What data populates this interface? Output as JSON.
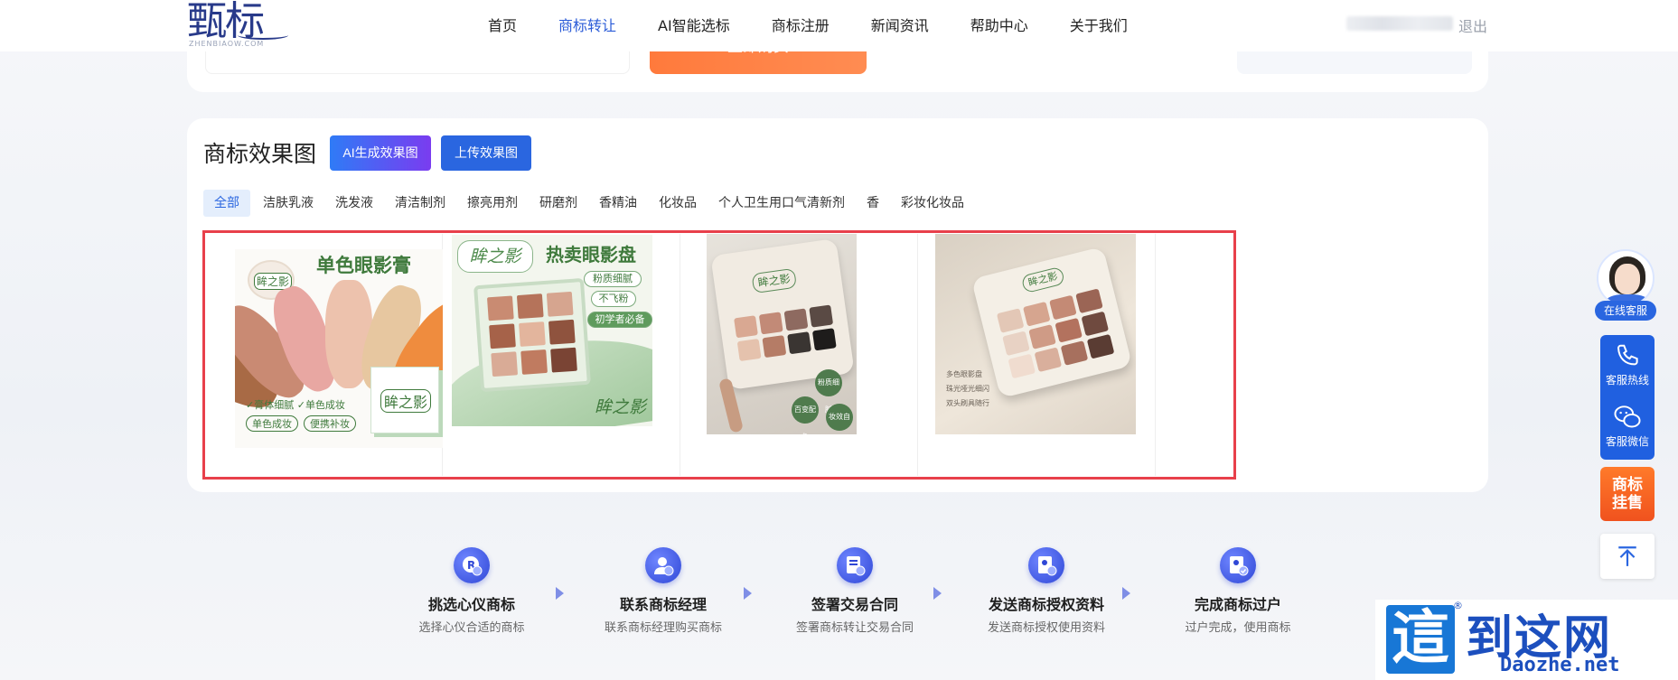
{
  "header": {
    "logo_text": "甄标",
    "logo_sub": "ZHENBIAOW.COM",
    "nav": [
      "首页",
      "商标转让",
      "AI智能选标",
      "商标注册",
      "新闻资讯",
      "帮助中心",
      "关于我们"
    ],
    "active_nav_index": 1,
    "logout": "退出"
  },
  "top_card": {
    "buy_label": "立即购买"
  },
  "effects": {
    "title": "商标效果图",
    "ai_button": "AI生成效果图",
    "upload_button": "上传效果图",
    "categories": [
      "全部",
      "洁肤乳液",
      "洗发液",
      "清洁制剂",
      "擦亮用剂",
      "研磨剂",
      "香精油",
      "化妆品",
      "个人卫生用口气清新剂",
      "香",
      "彩妆化妆品"
    ],
    "active_category_index": 0,
    "images": [
      {
        "heading": "单色眼影膏",
        "brand": "眸之影",
        "tags": [
          "膏体细腻",
          "单色成妆",
          "单色成妆",
          "便携补妆"
        ]
      },
      {
        "heading": "热卖眼影盘",
        "brand": "眸之影",
        "pills": [
          "粉质细腻",
          "不飞粉",
          "初学者必备"
        ]
      },
      {
        "brand": "眸之影",
        "drops": [
          "粉质细腻",
          "百变配色",
          "妆效自然"
        ]
      },
      {
        "brand": "眸之影",
        "features": [
          "多色眼影盘",
          "珠光哑光细闪",
          "双头刷具随行"
        ]
      }
    ]
  },
  "steps": [
    {
      "title": "挑选心仪商标",
      "desc": "选择心仪合适的商标",
      "icon": "trademark-pick-icon"
    },
    {
      "title": "联系商标经理",
      "desc": "联系商标经理购买商标",
      "icon": "contact-manager-icon"
    },
    {
      "title": "签署交易合同",
      "desc": "签署商标转让交易合同",
      "icon": "contract-icon"
    },
    {
      "title": "发送商标授权资料",
      "desc": "发送商标授权使用资料",
      "icon": "send-auth-icon"
    },
    {
      "title": "完成商标过户",
      "desc": "过户完成，使用商标",
      "icon": "transfer-complete-icon"
    }
  ],
  "side": {
    "online_service": "在线客服",
    "hotline": "客服热线",
    "wechat": "客服微信",
    "sell_line1": "商标",
    "sell_line2": "挂售"
  },
  "watermark": {
    "mark": "這",
    "reg": "®",
    "big": "到这网",
    "small": "Daozhe.net"
  },
  "colors": {
    "accent": "#2a66e0",
    "highlight_box": "#e8404b",
    "buy": "#ff7a3c",
    "brand_green": "#3f7a3c"
  }
}
